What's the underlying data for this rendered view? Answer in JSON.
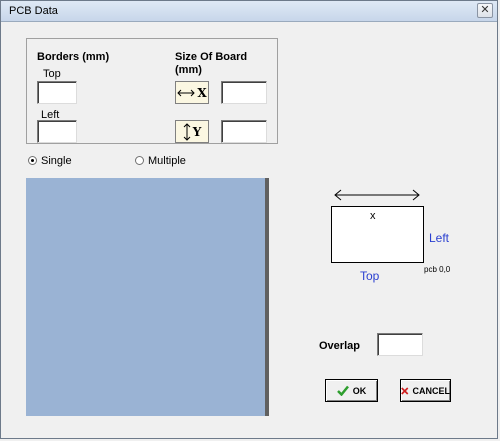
{
  "window": {
    "title": "PCB Data",
    "close_glyph": "✕"
  },
  "borders": {
    "heading": "Borders (mm)",
    "top_label": "Top",
    "left_label": "Left",
    "top_value": "",
    "left_value": ""
  },
  "board_size": {
    "heading_line1": "Size Of Board",
    "heading_line2": "(mm)",
    "x_label": "X",
    "y_label": "Y",
    "x_value": "",
    "y_value": ""
  },
  "mode": {
    "single_label": "Single",
    "multiple_label": "Multiple",
    "selected": "Single"
  },
  "diagram": {
    "origin_marker": "x",
    "left_label": "Left",
    "top_label": "Top",
    "origin_label": "pcb 0,0"
  },
  "overlap": {
    "label": "Overlap",
    "value": ""
  },
  "buttons": {
    "ok_label": "OK",
    "cancel_label": "CANCEL"
  },
  "colors": {
    "canvas": "#9ab3d4",
    "label_blue": "#2a3fd0",
    "ok_check": "#2e9e2e",
    "cancel_x": "#d02020"
  },
  "icons": [
    "close-icon",
    "horizontal-arrow-icon",
    "vertical-arrow-icon",
    "checkmark-icon",
    "x-mark-icon"
  ]
}
